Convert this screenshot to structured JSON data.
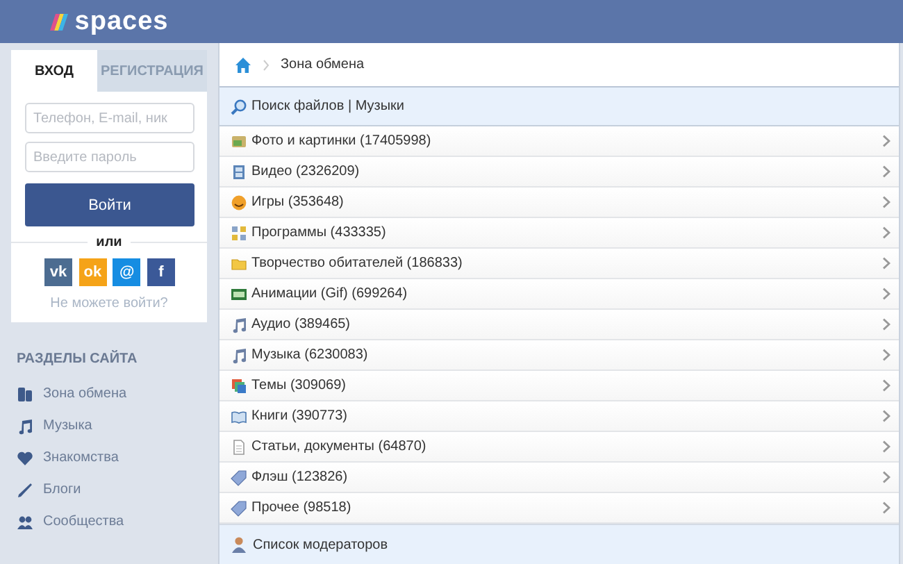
{
  "header": {
    "logo": "spaces"
  },
  "login": {
    "tabs": [
      {
        "label": "ВХОД",
        "selected": true
      },
      {
        "label": "РЕГИСТРАЦИЯ",
        "selected": false
      }
    ],
    "login_field": {
      "placeholder": "Телефон, E-mail, ник"
    },
    "password_field": {
      "placeholder": "Введите пароль"
    },
    "submit": "Войти",
    "separator": "или",
    "social": [
      {
        "label": "vk",
        "color": "#4c6c91"
      },
      {
        "label": "ok",
        "color": "#f5a318"
      },
      {
        "label": "@",
        "color": "#168de2"
      },
      {
        "label": "f",
        "color": "#3b5998"
      }
    ],
    "forgot_link": "Не можете войти?"
  },
  "sections": {
    "title": "РАЗДЕЛЫ САЙТА",
    "items": [
      {
        "kind": "exchange",
        "label": "Зона обмена"
      },
      {
        "kind": "music",
        "label": "Музыка"
      },
      {
        "kind": "dating",
        "label": "Знакомства"
      },
      {
        "kind": "blog",
        "label": "Блоги"
      },
      {
        "kind": "community",
        "label": "Сообщества"
      }
    ]
  },
  "breadcrumb": [
    "Зона обмена"
  ],
  "search_header": "Поиск файлов | Музыки",
  "categories": [
    {
      "kind": "photo",
      "label": "Фото и картинки (17405998)"
    },
    {
      "kind": "video",
      "label": "Видео (2326209)"
    },
    {
      "kind": "game",
      "label": "Игры (353648)"
    },
    {
      "kind": "apps",
      "label": "Программы (433335)"
    },
    {
      "kind": "folder",
      "label": "Творчество обитателей (186833)"
    },
    {
      "kind": "animation",
      "label": "Анимации (Gif) (699264)"
    },
    {
      "kind": "music",
      "label": "Аудио (389465)"
    },
    {
      "kind": "music",
      "label": "Музыка (6230083)"
    },
    {
      "kind": "themes",
      "label": "Темы (309069)"
    },
    {
      "kind": "book",
      "label": "Книги (390773)"
    },
    {
      "kind": "doc",
      "label": "Статьи, документы (64870)"
    },
    {
      "kind": "tag",
      "label": "Флэш (123826)"
    },
    {
      "kind": "tag",
      "label": "Прочее (98518)"
    }
  ],
  "moderators": "Список модераторов"
}
